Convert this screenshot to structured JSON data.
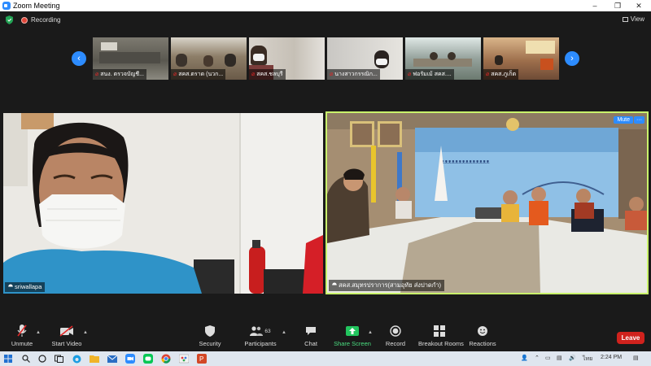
{
  "window": {
    "title": "Zoom Meeting",
    "minimize": "–",
    "maximize": "❐",
    "close": "✕"
  },
  "topbar": {
    "recording_label": "Recording",
    "view_label": "View"
  },
  "gallery": {
    "prev": "‹",
    "next": "›",
    "thumbs": [
      {
        "name": "สนง. ตรวจบัญชี...",
        "bg": "#6b6a62"
      },
      {
        "name": "สคส.ตราด (นวก...",
        "bg": "#7a6f60"
      },
      {
        "name": "สคส.ชลบุรี",
        "bg": "#c9c3b8"
      },
      {
        "name": "นางสาวกรรณิก...",
        "bg": "#b5b2ad"
      },
      {
        "name": "ฟอรัมเม้ สคส....",
        "bg": "#8a8f85"
      },
      {
        "name": "สคส.ภูเก็ต",
        "bg": "#8e6b52"
      }
    ]
  },
  "speaker_left": {
    "name": "sriwallapa"
  },
  "speaker_right": {
    "name": "สคส.สมุทรปราการ(สามอุทัย ส่งปาดกำ)",
    "mute_label": "Mute",
    "more_label": "···"
  },
  "toolbar": {
    "unmute": "Unmute",
    "start_video": "Start Video",
    "security": "Security",
    "participants": "Participants",
    "participants_count": "63",
    "chat": "Chat",
    "share_screen": "Share Screen",
    "record": "Record",
    "breakout_rooms": "Breakout Rooms",
    "reactions": "Reactions",
    "leave": "Leave"
  },
  "taskbar": {
    "language": "ไทย",
    "time": "2:24 PM"
  },
  "colors": {
    "zoom_blue": "#2D8CFF",
    "share_green": "#22c55e",
    "leave_red": "#d0221d",
    "active_border": "#c9f26b"
  }
}
